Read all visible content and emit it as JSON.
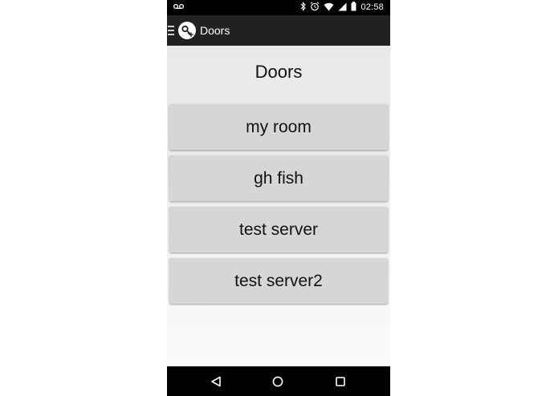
{
  "status_bar": {
    "time": "02:58",
    "icons": [
      "voicemail-icon",
      "bluetooth-icon",
      "alarm-icon",
      "wifi-icon",
      "signal-icon",
      "battery-icon"
    ]
  },
  "action_bar": {
    "title": "Doors",
    "icons": [
      "drawer-icon",
      "app-key-icon"
    ]
  },
  "main": {
    "heading": "Doors",
    "doors": [
      {
        "label": "my room"
      },
      {
        "label": "gh fish"
      },
      {
        "label": "test server"
      },
      {
        "label": "test server2"
      }
    ]
  },
  "nav_bar": {
    "icons": [
      "back-icon",
      "home-icon",
      "recents-icon"
    ]
  },
  "colors": {
    "status_bar": "#000000",
    "action_bar": "#212121",
    "button": "#d6d6d6",
    "background": "#ececec"
  }
}
